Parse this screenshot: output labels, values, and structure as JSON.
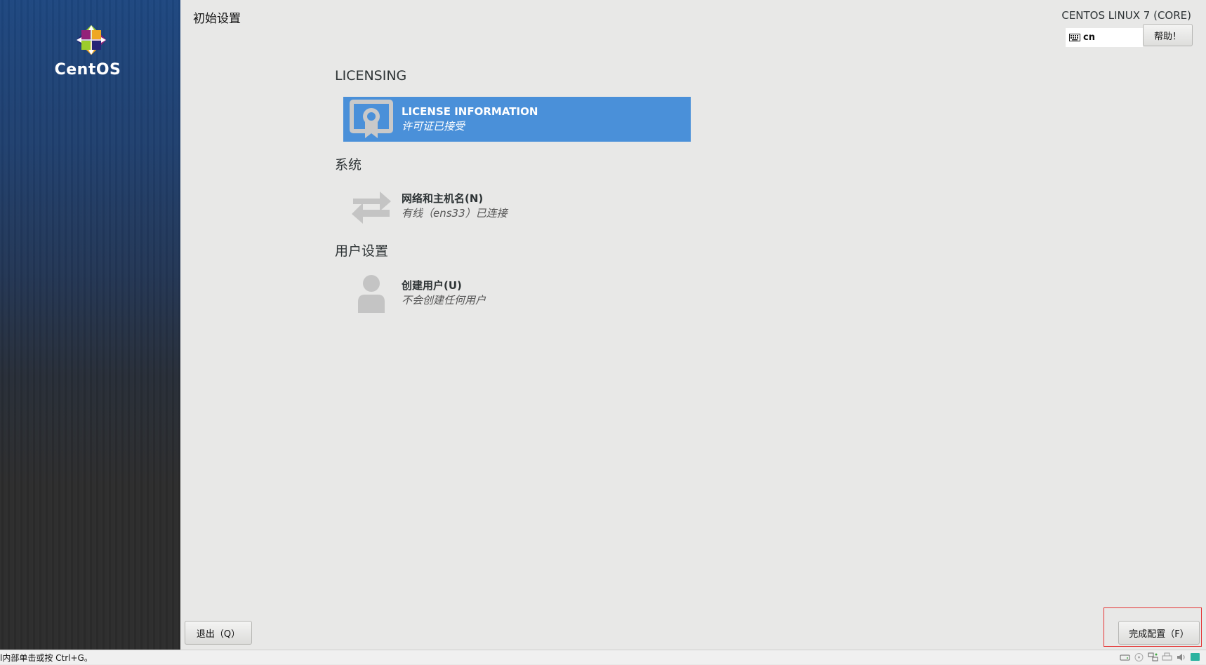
{
  "header": {
    "page_title": "初始设置",
    "product_title": "CENTOS LINUX 7 (CORE)",
    "keyboard_layout": "cn",
    "help_label": "帮助！"
  },
  "sidebar": {
    "logo_text": "CentOS"
  },
  "sections": [
    {
      "title": "LICENSING",
      "spokes": [
        {
          "name": "LICENSE INFORMATION",
          "status": "许可证已接受",
          "icon": "license-certificate-icon",
          "selected": true
        }
      ]
    },
    {
      "title": "系统",
      "spokes": [
        {
          "name": "网络和主机名(N)",
          "status": "有线（ens33）已连接",
          "icon": "network-arrows-icon",
          "selected": false
        }
      ]
    },
    {
      "title": "用户设置",
      "spokes": [
        {
          "name": "创建用户(U)",
          "status": "不会创建任何用户",
          "icon": "user-icon",
          "selected": false
        }
      ]
    }
  ],
  "footer": {
    "quit_label": "退出（Q）",
    "finish_label": "完成配置（F）"
  },
  "statusbar": {
    "text": "l内部单击或按 Ctrl+G。"
  },
  "colors": {
    "accent": "#4a90d9",
    "highlight_box": "#e53333",
    "sidebar_top": "#1d467f",
    "sidebar_bottom": "#2b2b2b"
  }
}
